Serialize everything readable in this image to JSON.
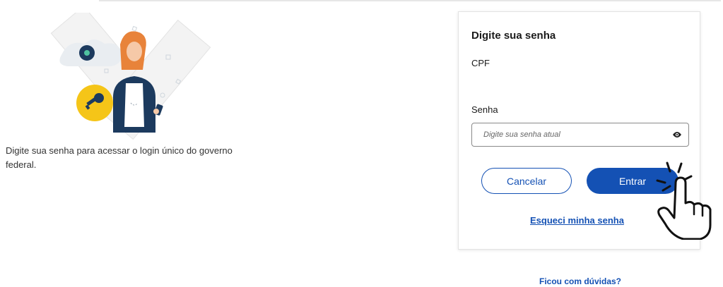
{
  "intro": {
    "text": "Digite sua senha para acessar o login único do governo federal."
  },
  "card": {
    "title": "Digite sua senha",
    "cpf_label": "CPF",
    "password_label": "Senha",
    "password_placeholder": "Digite sua senha atual",
    "cancel_label": "Cancelar",
    "enter_label": "Entrar",
    "forgot_link": "Esqueci minha senha"
  },
  "footer": {
    "help_link": "Ficou com dúvidas?"
  },
  "icons": {
    "eye": "eye-icon",
    "key": "key-icon",
    "hand": "hand-pointer-icon"
  },
  "colors": {
    "primary": "#1451b4",
    "key_badge": "#f5c518",
    "background": "#ffffff"
  }
}
